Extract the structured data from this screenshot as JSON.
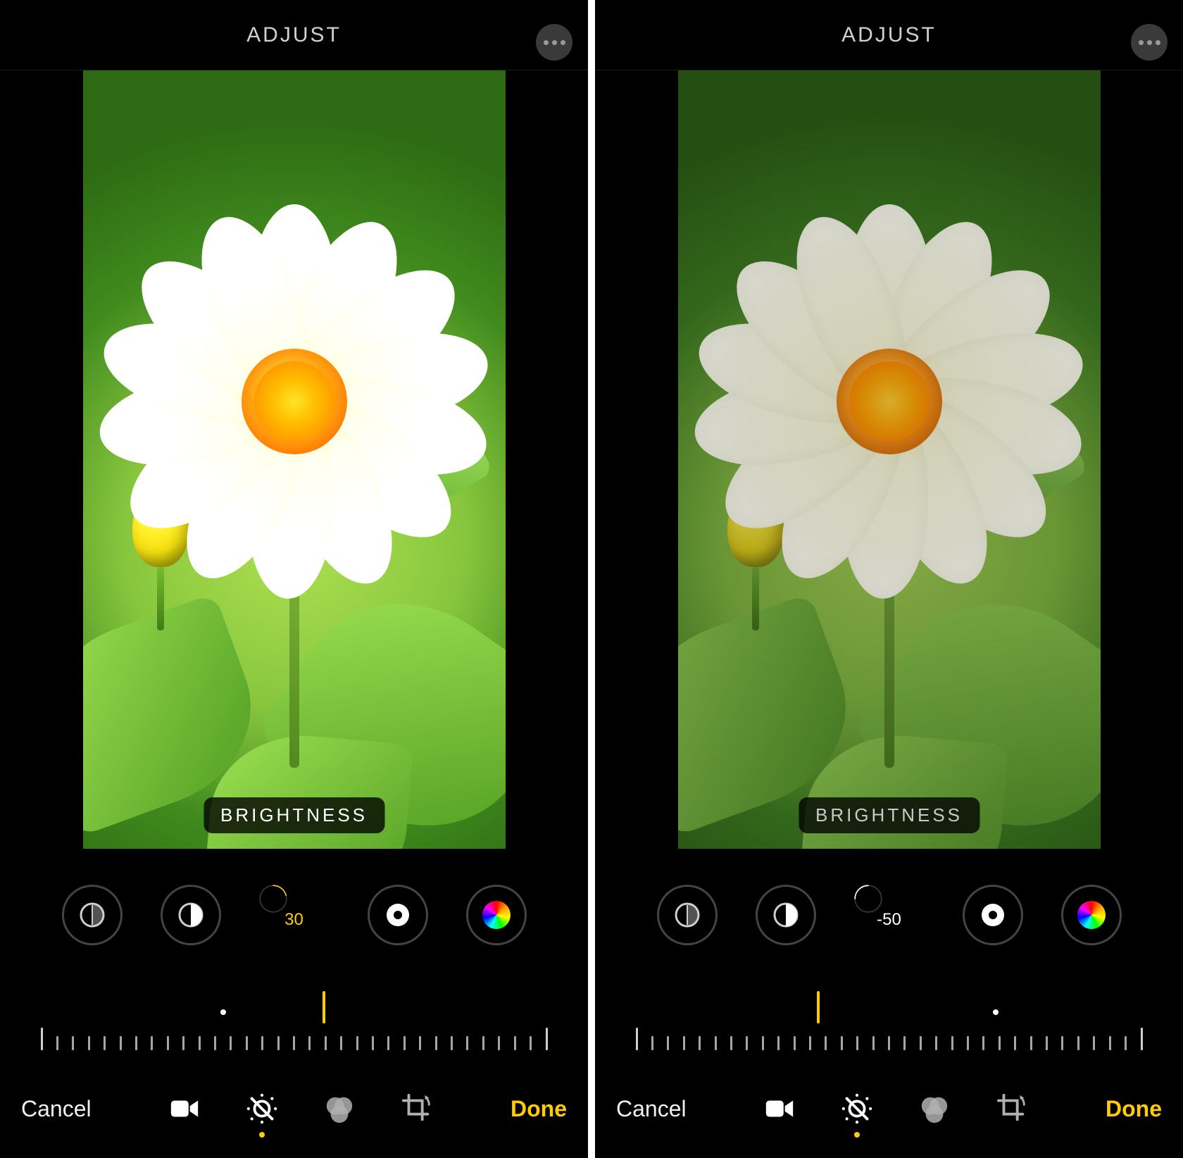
{
  "screens": [
    {
      "header": {
        "title": "ADJUST"
      },
      "label": "BRIGHTNESS",
      "dials": {
        "items": [
          "shadows",
          "contrast",
          "brightness",
          "blackpoint",
          "saturation"
        ],
        "active_index": 2,
        "value": "30",
        "value_pct": 30,
        "arc_color": "#ffcc00"
      },
      "ruler": {
        "needle_offset": 0.56,
        "origin_offset": 0.36
      },
      "footer": {
        "cancel": "Cancel",
        "done": "Done"
      },
      "image_filter": "bright"
    },
    {
      "header": {
        "title": "ADJUST"
      },
      "label": "BRIGHTNESS",
      "dials": {
        "items": [
          "shadows",
          "contrast",
          "brightness",
          "blackpoint",
          "saturation"
        ],
        "active_index": 2,
        "value": "-50",
        "value_pct": 50,
        "arc_color": "#ffffff"
      },
      "ruler": {
        "needle_offset": 0.36,
        "origin_offset": 0.71
      },
      "footer": {
        "cancel": "Cancel",
        "done": "Done"
      },
      "image_filter": "dim"
    }
  ]
}
